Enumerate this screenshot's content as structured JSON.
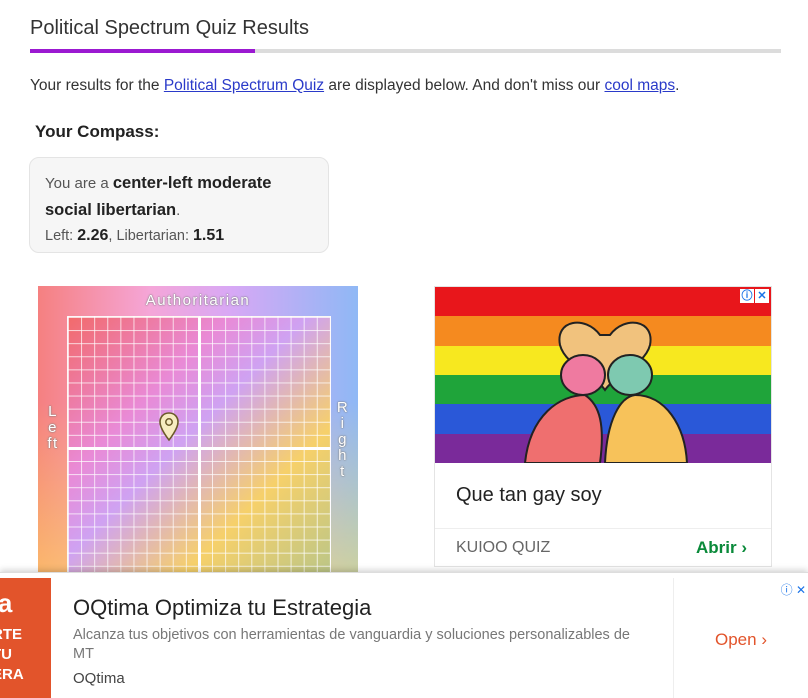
{
  "header": {
    "title": "Political Spectrum Quiz Results"
  },
  "intro": {
    "prefix": "Your results for the ",
    "quiz_link": "Political Spectrum Quiz",
    "middle": " are displayed below. And don't miss our ",
    "maps_link": "cool maps",
    "suffix": "."
  },
  "compass": {
    "heading": "Your Compass:",
    "you_are": "You are a ",
    "result_label": "center-left moderate social libertarian",
    "period": ".",
    "left_label": "Left: ",
    "left_value": "2.26",
    "sep": ", ",
    "lib_label": "Libertarian: ",
    "lib_value": "1.51",
    "chart": {
      "top_label": "Authoritarian",
      "left_label": "Left",
      "right_label": "Right"
    }
  },
  "ad_card": {
    "title": "Que tan gay soy",
    "brand": "KUIOO QUIZ",
    "cta": "Abrir",
    "flag_colors": [
      "#e8161b",
      "#f58a1f",
      "#f7e81f",
      "#1fa43a",
      "#2a58d8",
      "#7a2a9a"
    ]
  },
  "bottom_ad": {
    "logo_big": "na",
    "logo_lines": [
      "RTE",
      "TU",
      "ERA"
    ],
    "title": "OQtima Optimiza tu Estrategia",
    "description": "Alcanza tus objetivos con herramientas de vanguardia y soluciones personalizables de MT",
    "brand": "OQtima",
    "cta": "Open"
  },
  "colors": {
    "accent": "#9b19d1",
    "link": "#2a3ac9",
    "cta_green": "#0a8a3a",
    "cta_orange": "#e2542b"
  }
}
